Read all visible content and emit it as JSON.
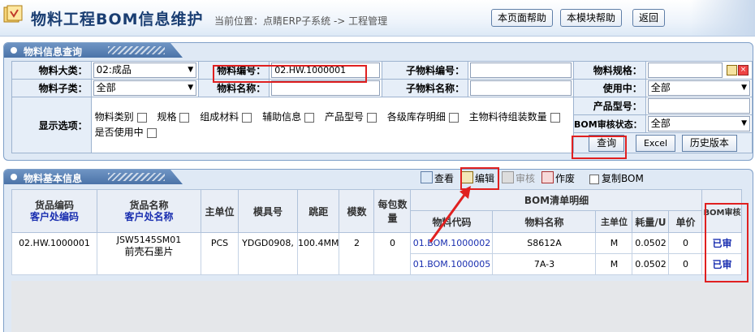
{
  "header": {
    "title": "物料工程BOM信息维护",
    "breadcrumb": "当前位置：点睛ERP子系统 -> 工程管理",
    "buttons": [
      "本页面帮助",
      "本模块帮助",
      "返回"
    ]
  },
  "query_panel": {
    "title": "物料信息查询",
    "fields": {
      "material_category_label": "物料大类：",
      "material_category_value": "02:成品",
      "material_code_label": "物料编号：",
      "material_code_value": "02.HW.1000001",
      "sub_code_label": "子物料编号：",
      "sub_code_value": "",
      "spec_label": "物料规格：",
      "spec_value": "",
      "subcategory_label": "物料子类：",
      "subcategory_value": "全部",
      "material_name_label": "物料名称：",
      "material_name_value": "",
      "sub_name_label": "子物料名称：",
      "sub_name_value": "",
      "in_use_label": "使用中：",
      "in_use_value": "全部",
      "model_label": "产品型号：",
      "model_value": "",
      "bom_status_label": "BOM审核状态：",
      "bom_status_value": "全部",
      "display_options_label": "显示选项："
    },
    "display_options": [
      "物料类别",
      "规格",
      "组成材料",
      "辅助信息",
      "产品型号",
      "各级库存明细",
      "主物料待组装数量",
      "是否使用中"
    ],
    "buttons": {
      "query": "查询",
      "excel": "Excel",
      "history": "历史版本"
    }
  },
  "info_panel": {
    "title": "物料基本信息",
    "toolbar": {
      "view": "查看",
      "edit": "编辑",
      "audit": "审核",
      "void": "作废",
      "copy_bom": "复制BOM"
    },
    "columns": {
      "goods_code": "货品编码",
      "customer_code": "客户处编码",
      "goods_name": "货品名称",
      "customer_name": "客户处名称",
      "main_unit": "主单位",
      "mold_no": "模具号",
      "pitch": "跳距",
      "mold_count": "模数",
      "per_pack": "每包数量",
      "bom_detail": "BOM清单明细",
      "mat_code": "物料代码",
      "mat_name": "物料名称",
      "sub_unit": "主单位",
      "consumption": "耗量/U",
      "unit_price": "单价",
      "bom_audit": "BOM审核"
    },
    "row": {
      "goods_code": "02.HW.1000001",
      "goods_name_1": "JSW5145SM01",
      "goods_name_2": "前壳石墨片",
      "main_unit": "PCS",
      "mold_no": "YDGD0908,",
      "pitch": "100.4MM",
      "mold_count": "2",
      "per_pack": "0",
      "bom_items": [
        {
          "code": "01.BOM.1000002",
          "name": "S8612A",
          "unit": "M",
          "consumption": "0.0502",
          "price": "0",
          "audit": "已审"
        },
        {
          "code": "01.BOM.1000005",
          "name": "7A-3",
          "unit": "M",
          "consumption": "0.0502",
          "price": "0",
          "audit": "已审"
        }
      ]
    }
  },
  "colors": {
    "accent": "#1a3e72",
    "panel": "#dfe9f5",
    "highlight": "#e02020",
    "link": "#1a2fb0"
  }
}
